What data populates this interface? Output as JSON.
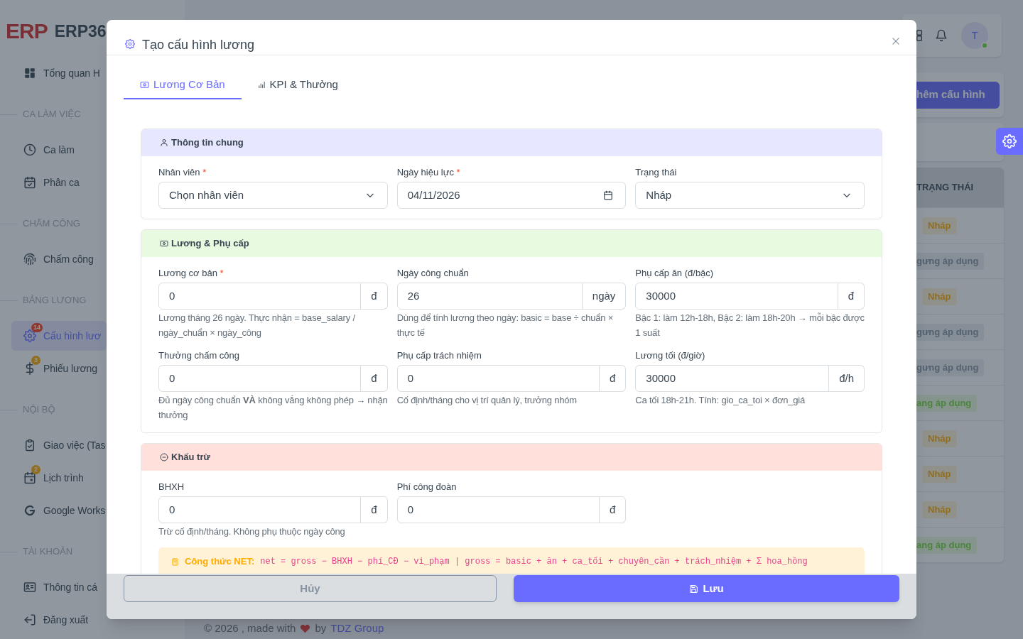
{
  "background": {
    "logo": {
      "mark": "ERP",
      "name": "ERP36"
    },
    "sidebar": {
      "items": [
        {
          "kind": "link",
          "label": "Tổng quan H",
          "selected": false
        },
        {
          "kind": "heading",
          "label": "CA LÀM VIỆC"
        },
        {
          "kind": "link",
          "label": "Ca làm",
          "selected": false
        },
        {
          "kind": "link",
          "label": "Phân ca",
          "selected": false
        },
        {
          "kind": "heading",
          "label": "CHẤM CÔNG"
        },
        {
          "kind": "link",
          "label": "Chấm công",
          "selected": false
        },
        {
          "kind": "heading",
          "label": "BẢNG LƯƠNG"
        },
        {
          "kind": "link",
          "label": "Cấu hình lươ",
          "selected": true,
          "badge": {
            "text": "14",
            "color": "#91372e"
          }
        },
        {
          "kind": "link",
          "label": "Phiếu lương",
          "selected": false,
          "badge": {
            "text": "3",
            "color": "#916e1f"
          }
        },
        {
          "kind": "heading",
          "label": "NỘI BỘ"
        },
        {
          "kind": "link",
          "label": "Giao việc (Tas",
          "selected": false
        },
        {
          "kind": "link",
          "label": "Lịch trình",
          "selected": false,
          "badge": {
            "text": "2",
            "color": "#916e1f"
          }
        },
        {
          "kind": "link",
          "label": "Google Works",
          "selected": false
        },
        {
          "kind": "heading",
          "label": "TÀI KHOẢN"
        },
        {
          "kind": "link",
          "label": "Thông tin cá",
          "selected": false
        },
        {
          "kind": "link",
          "label": "Đăng xuất",
          "selected": false
        }
      ]
    },
    "topbar": {
      "avatar": "T",
      "online": true
    },
    "add_button": "hêm cấu hình",
    "table": {
      "columns": [
        "TRẠNG THÁI"
      ],
      "rows": [
        {
          "kind": "draft",
          "status": "Nháp"
        },
        {
          "kind": "inactive",
          "status": "gưng áp dụng"
        },
        {
          "kind": "draft",
          "status": "Nháp"
        },
        {
          "kind": "inactive",
          "status": "gưng áp dụng"
        },
        {
          "kind": "inactive",
          "status": "gưng áp dụng"
        },
        {
          "kind": "active",
          "status": "ang áp dụng"
        },
        {
          "kind": "draft",
          "status": "Nháp"
        },
        {
          "kind": "draft",
          "status": "Nháp"
        },
        {
          "kind": "draft",
          "status": "Nháp"
        },
        {
          "kind": "active",
          "status": "ang áp dụng"
        }
      ]
    },
    "footer": {
      "text": "© 2026 , made with",
      "by": "by",
      "link": "TDZ Group"
    }
  },
  "modal": {
    "title": "Tạo cấu hình lương",
    "tabs": [
      {
        "label": "Lương Cơ Bản",
        "selected": true
      },
      {
        "label": "KPI & Thưởng",
        "selected": false
      }
    ],
    "sections": [
      {
        "kind": "general",
        "title": "Thông tin chung",
        "fields": [
          {
            "kind": "select",
            "label": "Nhân viên",
            "required_mark": "*",
            "value": "Chọn nhân viên"
          },
          {
            "kind": "date",
            "label": "Ngày hiệu lực",
            "required_mark": "*",
            "value": "04/11/2026"
          },
          {
            "kind": "select",
            "label": "Trạng thái",
            "value": "Nháp"
          }
        ]
      },
      {
        "kind": "salary",
        "title": "Lương & Phụ cấp",
        "fields": [
          {
            "kind": "amount",
            "label": "Lương cơ bản",
            "required_mark": "*",
            "value": "0",
            "unit": "đ",
            "help": "Lương tháng 26 ngày. Thực nhận = base_salary / ngày_chuẩn × ngày_công"
          },
          {
            "kind": "amount",
            "label": "Ngày công chuẩn",
            "value": "26",
            "unit": "ngày",
            "help": "Dùng để tính lương theo ngày: basic = base ÷ chuẩn × thực tế"
          },
          {
            "kind": "amount",
            "label": "Phụ cấp ăn (đ/bậc)",
            "value": "30000",
            "unit": "đ",
            "help": "Bậc 1: làm 12h-18h, Bậc 2: làm 18h-20h → mỗi bậc được 1 suất"
          },
          {
            "kind": "amount",
            "label": "Thưởng chấm công",
            "value": "0",
            "unit": "đ",
            "help": "Đủ ngày công chuẩn **VÀ** không vắng không phép → nhận thưởng"
          },
          {
            "kind": "amount",
            "label": "Phụ cấp trách nhiệm",
            "value": "0",
            "unit": "đ",
            "help": "Cố định/tháng cho vị trí quản lý, trưởng nhóm"
          },
          {
            "kind": "amount",
            "label": "Lương tối (đ/giờ)",
            "value": "30000",
            "unit": "đ/h",
            "help": "Ca tối 18h-21h. Tính: gio_ca_toi × đơn_giá"
          }
        ]
      },
      {
        "kind": "deduction",
        "title": "Khấu trừ",
        "fields": [
          {
            "kind": "amount",
            "label": "BHXH",
            "value": "0",
            "unit": "đ",
            "help": "Trừ cố định/tháng. Không phụ thuộc ngày công"
          },
          {
            "kind": "amount",
            "label": "Phí công đoàn",
            "value": "0",
            "unit": "đ"
          }
        ],
        "formula": {
          "label": "Công thức NET:",
          "text": "net = gross − BHXH − phí_CĐ − vi_phạm | gross = basic + ăn + ca_tối + chuyên_cần + trách_nhiệm + Σ hoa_hồng"
        }
      }
    ],
    "buttons": [
      {
        "kind": "secondary",
        "label": "Hủy"
      },
      {
        "kind": "primary",
        "label": "Lưu"
      }
    ]
  }
}
